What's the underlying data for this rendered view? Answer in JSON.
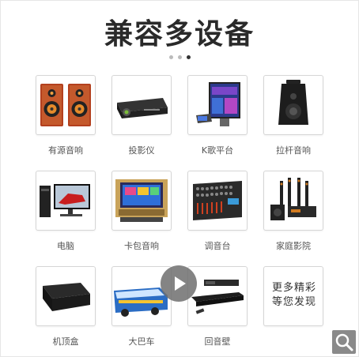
{
  "title": "兼容多设备",
  "carousel": {
    "count": 3,
    "active_index": 2
  },
  "devices": [
    {
      "label": "有源音响",
      "icon": "speakers-icon"
    },
    {
      "label": "投影仪",
      "icon": "projector-icon"
    },
    {
      "label": "K歌平台",
      "icon": "karaoke-display-icon"
    },
    {
      "label": "拉杆音响",
      "icon": "trolley-speaker-icon"
    },
    {
      "label": "电脑",
      "icon": "computer-icon"
    },
    {
      "label": "卡包音响",
      "icon": "ktv-speaker-icon"
    },
    {
      "label": "调音台",
      "icon": "mixer-icon"
    },
    {
      "label": "家庭影院",
      "icon": "home-theater-icon"
    },
    {
      "label": "机顶盒",
      "icon": "set-top-box-icon"
    },
    {
      "label": "大巴车",
      "icon": "bus-icon"
    },
    {
      "label": "回音壁",
      "icon": "soundbar-icon"
    }
  ],
  "more": {
    "line1": "更多精彩",
    "line2": "等您发现"
  }
}
